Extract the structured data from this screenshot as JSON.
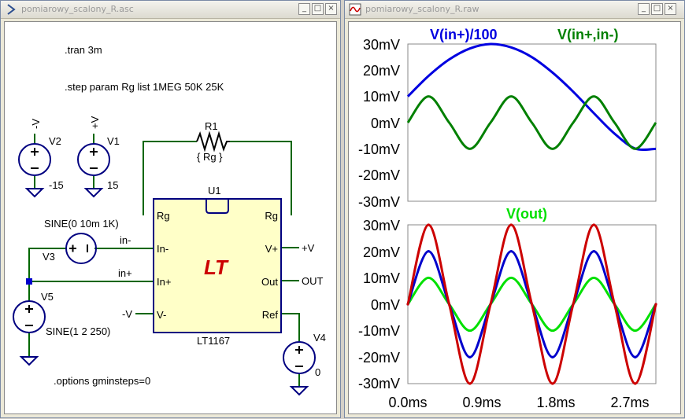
{
  "schematic_window": {
    "title": "pomiarowy_scalony_R.asc",
    "buttons": [
      "_",
      "□",
      "×"
    ],
    "directives": {
      "tran": ".tran 3m",
      "step": ".step param Rg  list 1MEG  50K 25K",
      "options": ".options gminsteps=0"
    },
    "resistor": {
      "name": "R1",
      "value": "{ Rg }"
    },
    "ic": {
      "name": "U1",
      "part": "LT1167",
      "logo": "LT",
      "pins_left": [
        "Rg",
        "In-",
        "In+",
        "V-"
      ],
      "pins_right": [
        "Rg",
        "V+",
        "Out",
        "Ref"
      ]
    },
    "sources": {
      "v2": {
        "name": "V2",
        "net": "-V",
        "value": "-15"
      },
      "v1": {
        "name": "V1",
        "net": "+V",
        "value": "15"
      },
      "v3": {
        "name": "V3",
        "value": "SINE(0 10m 1K)"
      },
      "v5": {
        "name": "V5",
        "value": "SINE(1 2 250)"
      },
      "v4": {
        "name": "V4",
        "value": "0"
      }
    },
    "net_labels": {
      "in_minus": "in-",
      "in_plus": "in+",
      "v_minus": "-V",
      "v_plus": "+V",
      "out": "OUT"
    }
  },
  "waveform_window": {
    "title": "pomiarowy_scalony_R.raw",
    "buttons": [
      "_",
      "□",
      "×"
    ],
    "x_ticks": [
      "0.0ms",
      "0.9ms",
      "1.8ms",
      "2.7ms"
    ]
  },
  "chart_data": [
    {
      "type": "line",
      "title": "",
      "x_unit": "ms",
      "xlim": [
        0,
        3.0
      ],
      "ylim": [
        -30,
        30
      ],
      "y_unit": "mV",
      "y_ticks": [
        "30mV",
        "20mV",
        "10mV",
        "0mV",
        "-10mV",
        "-20mV",
        "-30mV"
      ],
      "grid": false,
      "legend": "top",
      "series": [
        {
          "name": "V(in+)/100",
          "color": "#0000e0",
          "x": [
            0,
            0.25,
            0.5,
            0.75,
            1.0,
            1.25,
            1.5,
            1.75,
            2.0,
            2.25,
            2.5,
            2.75,
            3.0
          ],
          "y": [
            10,
            17.8,
            24.1,
            28.3,
            30,
            28.7,
            25,
            19.1,
            11.8,
            3.6,
            -4.2,
            -9.9,
            -10
          ]
        },
        {
          "name": "V(in+,in-)",
          "color": "#008000",
          "x": [
            0,
            0.25,
            0.5,
            0.75,
            1.0,
            1.25,
            1.5,
            1.75,
            2.0,
            2.25,
            2.5,
            2.75,
            3.0
          ],
          "y": [
            0,
            10,
            0,
            -10,
            0,
            10,
            0,
            -10,
            0,
            10,
            0,
            -10,
            0
          ]
        }
      ]
    },
    {
      "type": "line",
      "title": "",
      "x_unit": "ms",
      "xlim": [
        0,
        3.0
      ],
      "ylim": [
        -30,
        30
      ],
      "y_unit": "mV",
      "y_ticks": [
        "30mV",
        "20mV",
        "10mV",
        "0mV",
        "-10mV",
        "-20mV",
        "-30mV"
      ],
      "grid": false,
      "legend": "top",
      "series": [
        {
          "name": "V(out)",
          "color": "#00e000",
          "x": [
            0,
            0.25,
            0.5,
            0.75,
            1.0,
            1.25,
            1.5,
            1.75,
            2.0,
            2.25,
            2.5,
            2.75,
            3.0
          ],
          "y": [
            0,
            10,
            0,
            -10,
            0,
            10,
            0,
            -10,
            0,
            10,
            0,
            -10,
            0
          ]
        },
        {
          "name": "",
          "color": "#0000cc",
          "x": [
            0,
            0.25,
            0.5,
            0.75,
            1.0,
            1.25,
            1.5,
            1.75,
            2.0,
            2.25,
            2.5,
            2.75,
            3.0
          ],
          "y": [
            0,
            20,
            0,
            -20,
            0,
            20,
            0,
            -20,
            0,
            20,
            0,
            -20,
            0
          ]
        },
        {
          "name": "",
          "color": "#cc0000",
          "x": [
            0,
            0.25,
            0.5,
            0.75,
            1.0,
            1.25,
            1.5,
            1.75,
            2.0,
            2.25,
            2.5,
            2.75,
            3.0
          ],
          "y": [
            0,
            30,
            0,
            -30,
            0,
            30,
            0,
            -30,
            0,
            30,
            0,
            -30,
            0
          ]
        }
      ]
    }
  ]
}
